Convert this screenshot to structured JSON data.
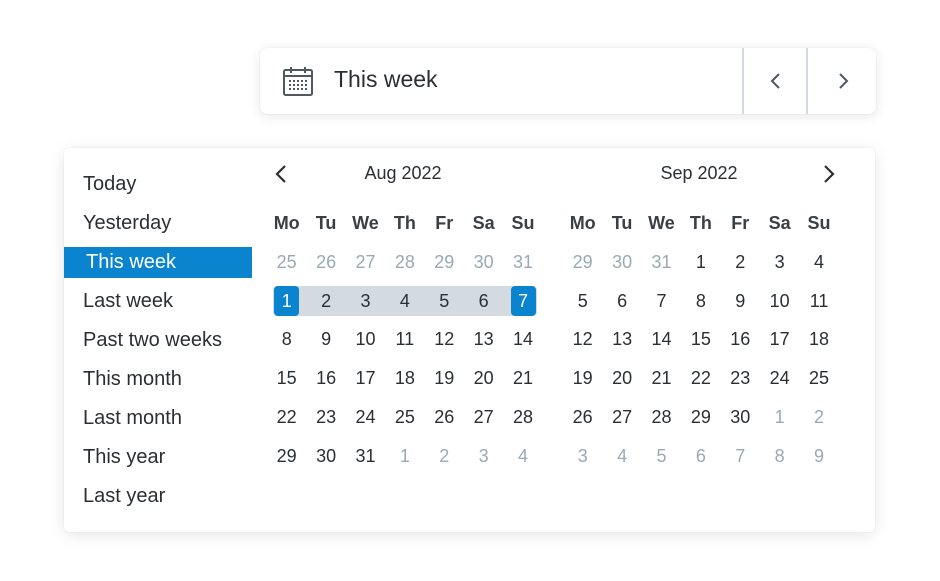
{
  "topbar": {
    "icon": "calendar-icon",
    "label": "This week",
    "prev_icon": "chevron-left-icon",
    "next_icon": "chevron-right-icon"
  },
  "presets": [
    "Today",
    "Yesterday",
    "This week",
    "Last week",
    "Past two weeks",
    "This month",
    "Last month",
    "This year",
    "Last year"
  ],
  "active_preset": "This week",
  "weekdays": [
    "Mo",
    "Tu",
    "We",
    "Th",
    "Fr",
    "Sa",
    "Su"
  ],
  "months": [
    {
      "title": "Aug 2022",
      "weeks": [
        [
          [
            "25",
            1
          ],
          [
            "26",
            1
          ],
          [
            "27",
            1
          ],
          [
            "28",
            1
          ],
          [
            "29",
            1
          ],
          [
            "30",
            1
          ],
          [
            "31",
            1
          ]
        ],
        [
          [
            "1",
            0
          ],
          [
            "2",
            0
          ],
          [
            "3",
            0
          ],
          [
            "4",
            0
          ],
          [
            "5",
            0
          ],
          [
            "6",
            0
          ],
          [
            "7",
            0
          ]
        ],
        [
          [
            "8",
            0
          ],
          [
            "9",
            0
          ],
          [
            "10",
            0
          ],
          [
            "11",
            0
          ],
          [
            "12",
            0
          ],
          [
            "13",
            0
          ],
          [
            "14",
            0
          ]
        ],
        [
          [
            "15",
            0
          ],
          [
            "16",
            0
          ],
          [
            "17",
            0
          ],
          [
            "18",
            0
          ],
          [
            "19",
            0
          ],
          [
            "20",
            0
          ],
          [
            "21",
            0
          ]
        ],
        [
          [
            "22",
            0
          ],
          [
            "23",
            0
          ],
          [
            "24",
            0
          ],
          [
            "25",
            0
          ],
          [
            "26",
            0
          ],
          [
            "27",
            0
          ],
          [
            "28",
            0
          ]
        ],
        [
          [
            "29",
            0
          ],
          [
            "30",
            0
          ],
          [
            "31",
            0
          ],
          [
            "1",
            1
          ],
          [
            "2",
            1
          ],
          [
            "3",
            1
          ],
          [
            "4",
            1
          ]
        ]
      ]
    },
    {
      "title": "Sep 2022",
      "weeks": [
        [
          [
            "29",
            1
          ],
          [
            "30",
            1
          ],
          [
            "31",
            1
          ],
          [
            "1",
            0
          ],
          [
            "2",
            0
          ],
          [
            "3",
            0
          ],
          [
            "4",
            0
          ]
        ],
        [
          [
            "5",
            0
          ],
          [
            "6",
            0
          ],
          [
            "7",
            0
          ],
          [
            "8",
            0
          ],
          [
            "9",
            0
          ],
          [
            "10",
            0
          ],
          [
            "11",
            0
          ]
        ],
        [
          [
            "12",
            0
          ],
          [
            "13",
            0
          ],
          [
            "14",
            0
          ],
          [
            "15",
            0
          ],
          [
            "16",
            0
          ],
          [
            "17",
            0
          ],
          [
            "18",
            0
          ]
        ],
        [
          [
            "19",
            0
          ],
          [
            "20",
            0
          ],
          [
            "21",
            0
          ],
          [
            "22",
            0
          ],
          [
            "23",
            0
          ],
          [
            "24",
            0
          ],
          [
            "25",
            0
          ]
        ],
        [
          [
            "26",
            0
          ],
          [
            "27",
            0
          ],
          [
            "28",
            0
          ],
          [
            "29",
            0
          ],
          [
            "30",
            0
          ],
          [
            "1",
            1
          ],
          [
            "2",
            1
          ]
        ],
        [
          [
            "3",
            1
          ],
          [
            "4",
            1
          ],
          [
            "5",
            1
          ],
          [
            "6",
            1
          ],
          [
            "7",
            1
          ],
          [
            "8",
            1
          ],
          [
            "9",
            1
          ]
        ]
      ]
    }
  ],
  "selected_range": {
    "month": "Aug 2022",
    "start": "1",
    "end": "7"
  },
  "colors": {
    "accent": "#0a84cf",
    "range_fill": "#d3dbe0",
    "muted_text": "#9aa9b3",
    "text": "#2b2f33"
  }
}
